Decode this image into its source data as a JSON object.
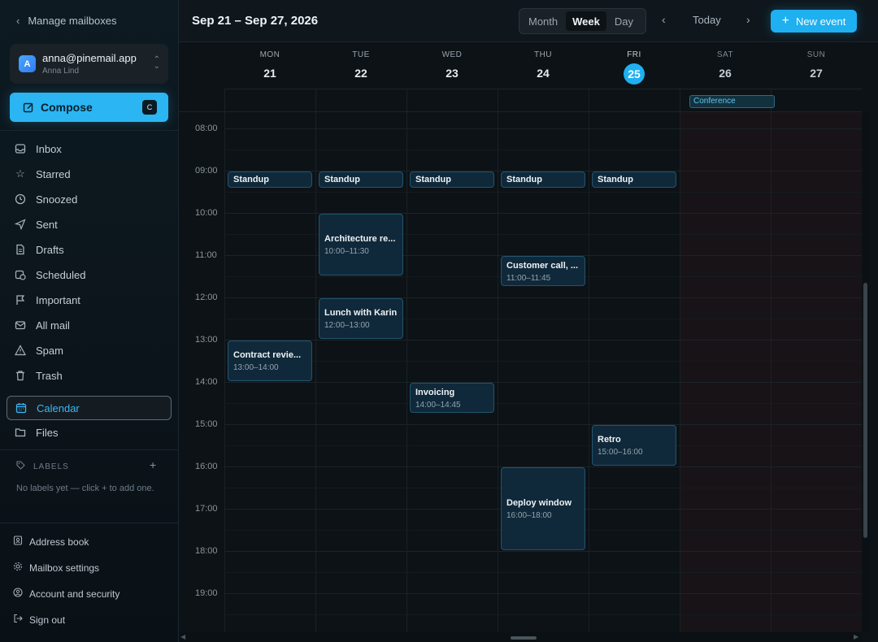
{
  "sidebar": {
    "manage_label": "Manage mailboxes",
    "account": {
      "avatar_letter": "A",
      "email": "anna@pinemail.app",
      "name": "Anna Lind"
    },
    "compose": {
      "label": "Compose",
      "shortcut": "C"
    },
    "nav": [
      {
        "label": "Inbox",
        "icon": "inbox-icon"
      },
      {
        "label": "Starred",
        "icon": "star-icon"
      },
      {
        "label": "Snoozed",
        "icon": "clock-icon"
      },
      {
        "label": "Sent",
        "icon": "send-icon"
      },
      {
        "label": "Drafts",
        "icon": "file-icon"
      },
      {
        "label": "Scheduled",
        "icon": "calendar-clock-icon"
      },
      {
        "label": "Important",
        "icon": "flag-icon"
      },
      {
        "label": "All mail",
        "icon": "mail-icon"
      },
      {
        "label": "Spam",
        "icon": "warning-icon"
      },
      {
        "label": "Trash",
        "icon": "trash-icon"
      },
      {
        "label": "Calendar",
        "icon": "calendar-icon",
        "active": true
      },
      {
        "label": "Files",
        "icon": "folder-icon"
      }
    ],
    "labels": {
      "heading": "LABELS",
      "empty_text": "No labels yet — click + to add one."
    },
    "footer": [
      {
        "label": "Address book",
        "icon": "address-book-icon"
      },
      {
        "label": "Mailbox settings",
        "icon": "gear-icon"
      },
      {
        "label": "Account and security",
        "icon": "user-circle-icon"
      },
      {
        "label": "Sign out",
        "icon": "sign-out-icon"
      }
    ]
  },
  "calendar": {
    "range_title": "Sep 21 – Sep 27, 2026",
    "views": [
      "Month",
      "Week",
      "Day"
    ],
    "active_view": "Week",
    "today_label": "Today",
    "new_event_label": "New event",
    "accent_color": "#1eb0f0",
    "days": [
      {
        "name": "MON",
        "date": "21"
      },
      {
        "name": "TUE",
        "date": "22"
      },
      {
        "name": "WED",
        "date": "23"
      },
      {
        "name": "THU",
        "date": "24"
      },
      {
        "name": "FRI",
        "date": "25",
        "today": true
      },
      {
        "name": "SAT",
        "date": "26",
        "weekend": true
      },
      {
        "name": "SUN",
        "date": "27",
        "weekend": true
      }
    ],
    "all_day_events": [
      {
        "title": "Conference",
        "day": 5
      }
    ],
    "hours": [
      "08:00",
      "09:00",
      "10:00",
      "11:00",
      "12:00",
      "13:00",
      "14:00",
      "15:00",
      "16:00",
      "17:00",
      "18:00",
      "19:00"
    ],
    "events": [
      {
        "title": "Standup",
        "day": 0,
        "start": "09:00",
        "end": "09:25"
      },
      {
        "title": "Standup",
        "day": 1,
        "start": "09:00",
        "end": "09:25"
      },
      {
        "title": "Standup",
        "day": 2,
        "start": "09:00",
        "end": "09:25"
      },
      {
        "title": "Standup",
        "day": 3,
        "start": "09:00",
        "end": "09:25"
      },
      {
        "title": "Standup",
        "day": 4,
        "start": "09:00",
        "end": "09:25"
      },
      {
        "title": "Architecture re...",
        "day": 1,
        "start": "10:00",
        "end": "11:30",
        "time": "10:00–11:30"
      },
      {
        "title": "Customer call, ...",
        "day": 3,
        "start": "11:00",
        "end": "11:45",
        "time": "11:00–11:45"
      },
      {
        "title": "Lunch with Karin",
        "day": 1,
        "start": "12:00",
        "end": "13:00",
        "time": "12:00–13:00"
      },
      {
        "title": "Contract revie...",
        "day": 0,
        "start": "13:00",
        "end": "14:00",
        "time": "13:00–14:00"
      },
      {
        "title": "Invoicing",
        "day": 2,
        "start": "14:00",
        "end": "14:45",
        "time": "14:00–14:45"
      },
      {
        "title": "Retro",
        "day": 4,
        "start": "15:00",
        "end": "16:00",
        "time": "15:00–16:00"
      },
      {
        "title": "Deploy window",
        "day": 3,
        "start": "16:00",
        "end": "18:00",
        "time": "16:00–18:00"
      }
    ]
  }
}
